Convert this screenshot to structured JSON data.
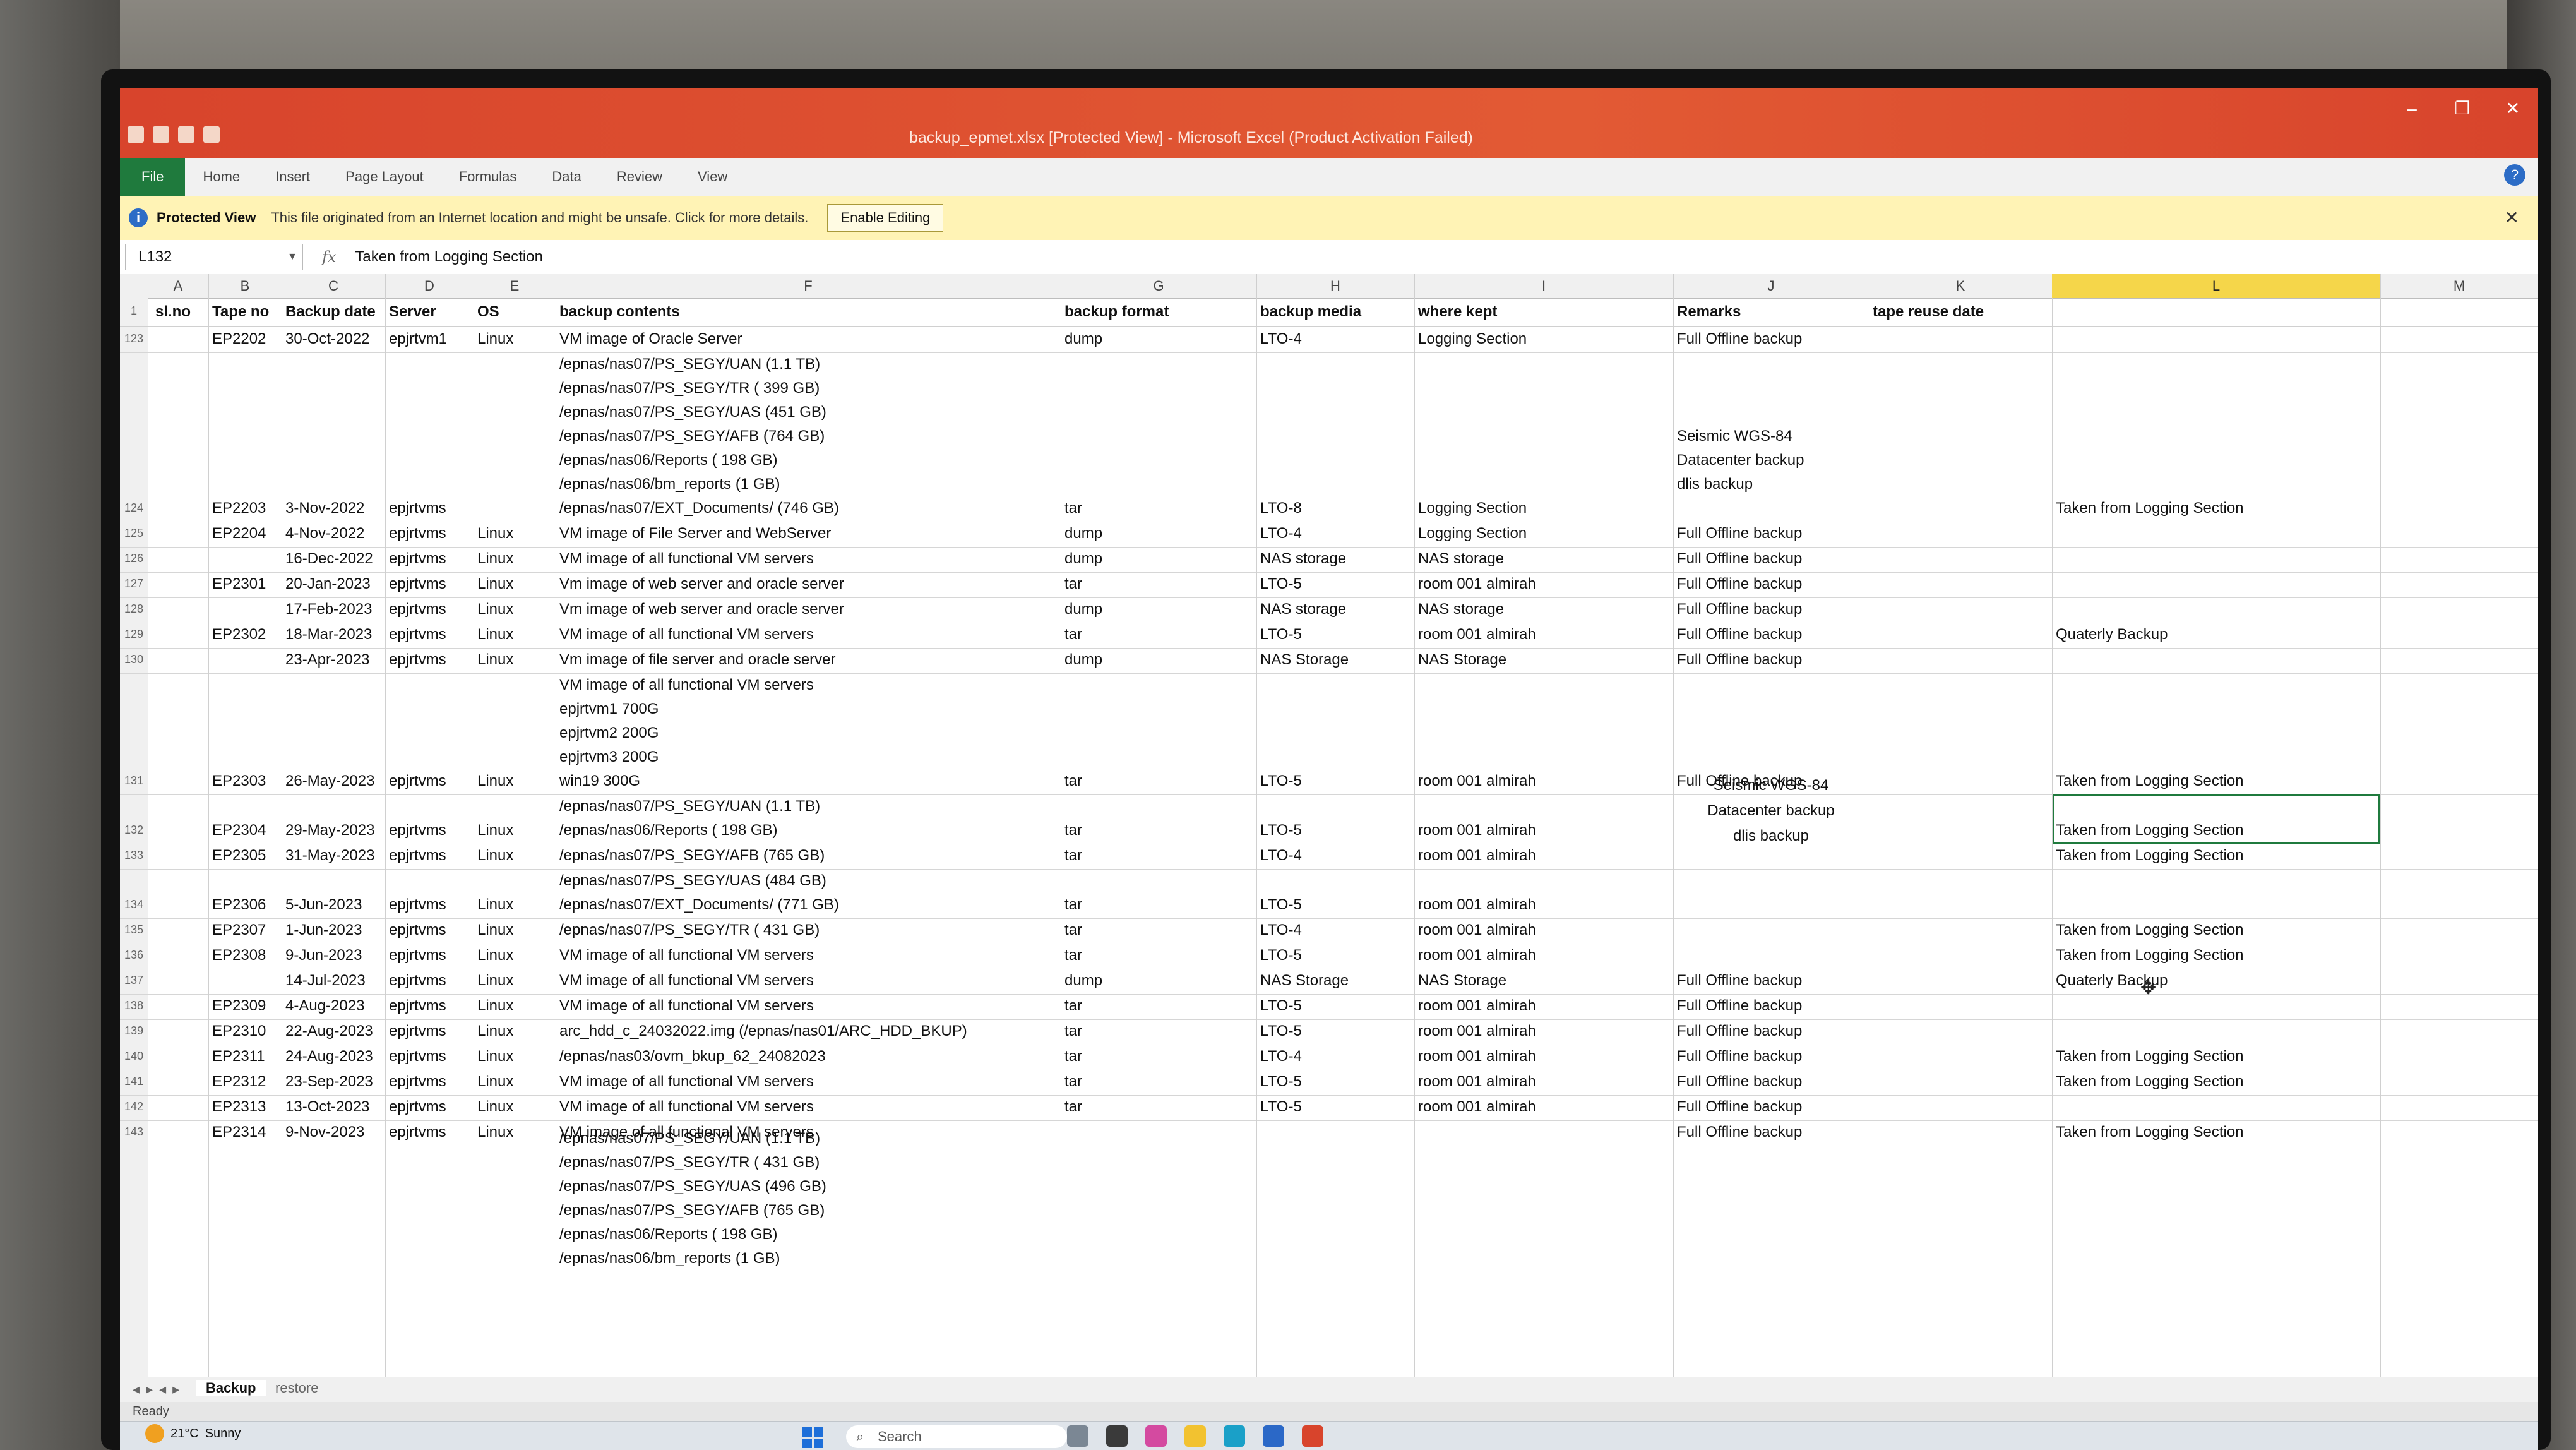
{
  "window": {
    "title": "backup_epmet.xlsx [Protected View] - Microsoft Excel (Product Activation Failed)"
  },
  "ribbon": {
    "tabs": [
      "File",
      "Home",
      "Insert",
      "Page Layout",
      "Formulas",
      "Data",
      "Review",
      "View"
    ]
  },
  "protected_view": {
    "label": "Protected View",
    "message": "This file originated from an Internet location and might be unsafe. Click for more details.",
    "button": "Enable Editing"
  },
  "formula_bar": {
    "name_box": "L132",
    "fx": "fx",
    "value": "Taken from Logging Section"
  },
  "columns": [
    "A",
    "B",
    "C",
    "D",
    "E",
    "F",
    "G",
    "H",
    "I",
    "J",
    "K",
    "L",
    "M"
  ],
  "header_row": {
    "row_num": "1",
    "sl_no": "sl.no",
    "tape_no": "Tape no",
    "backup_date": "Backup date",
    "server": "Server",
    "os": "OS",
    "backup_contents": "backup contents",
    "backup_format": "backup format",
    "backup_media": "backup media",
    "where_kept": "where kept",
    "remarks": "Remarks",
    "tape_reuse_date": "tape reuse date"
  },
  "rows": [
    {
      "num": "123",
      "tape": "EP2202",
      "date": "30-Oct-2022",
      "server": "epjrtvm1",
      "os": "Linux",
      "contents": "VM image of Oracle Server",
      "format": "dump",
      "media": "LTO-4",
      "kept": "Logging Section",
      "remarks": "Full Offline backup",
      "note": ""
    },
    {
      "num": "124",
      "tape": "EP2203",
      "date": "3-Nov-2022",
      "server": "epjrtvms",
      "os": "",
      "contents_lines": [
        "/epnas/nas07/PS_SEGY/UAN (1.1 TB)",
        "/epnas/nas07/PS_SEGY/TR ( 399 GB)",
        "/epnas/nas07/PS_SEGY/UAS (451 GB)",
        "/epnas/nas07/PS_SEGY/AFB (764 GB)",
        "/epnas/nas06/Reports ( 198 GB)",
        "/epnas/nas06/bm_reports (1 GB)",
        "/epnas/nas07/EXT_Documents/ (746 GB)"
      ],
      "format": "tar",
      "media": "LTO-8",
      "kept": "Logging Section",
      "remarks_lines": [
        "Seismic WGS-84",
        "Datacenter backup",
        "dlis backup"
      ],
      "note": "Taken from Logging Section"
    },
    {
      "num": "125",
      "tape": "EP2204",
      "date": "4-Nov-2022",
      "server": "epjrtvms",
      "os": "Linux",
      "contents": "VM image of File Server and WebServer",
      "format": "dump",
      "media": "LTO-4",
      "kept": "Logging Section",
      "remarks": "Full Offline backup",
      "note": ""
    },
    {
      "num": "126",
      "tape": "",
      "date": "16-Dec-2022",
      "server": "epjrtvms",
      "os": "Linux",
      "contents": "VM image of all functional VM servers",
      "format": "dump",
      "media": "NAS storage",
      "kept": "NAS storage",
      "remarks": "Full Offline backup",
      "note": ""
    },
    {
      "num": "127",
      "tape": "EP2301",
      "date": "20-Jan-2023",
      "server": "epjrtvms",
      "os": "Linux",
      "contents": "Vm image of web server and oracle server",
      "format": "tar",
      "media": "LTO-5",
      "kept": "room 001 almirah",
      "remarks": "Full Offline backup",
      "note": ""
    },
    {
      "num": "128",
      "tape": "",
      "date": "17-Feb-2023",
      "server": "epjrtvms",
      "os": "Linux",
      "contents": "Vm image of web server and oracle server",
      "format": "dump",
      "media": "NAS storage",
      "kept": "NAS storage",
      "remarks": "Full Offline backup",
      "note": ""
    },
    {
      "num": "129",
      "tape": "EP2302",
      "date": "18-Mar-2023",
      "server": "epjrtvms",
      "os": "Linux",
      "contents": "VM image of all functional VM servers",
      "format": "tar",
      "media": "LTO-5",
      "kept": "room 001 almirah",
      "remarks": "Full Offline backup",
      "note": "Quaterly Backup"
    },
    {
      "num": "130",
      "tape": "",
      "date": "23-Apr-2023",
      "server": "epjrtvms",
      "os": "Linux",
      "contents": "Vm image of file server and oracle server",
      "format": "dump",
      "media": "NAS Storage",
      "kept": "NAS Storage",
      "remarks": "Full Offline backup",
      "note": ""
    },
    {
      "num": "131",
      "tape": "EP2303",
      "date": "26-May-2023",
      "server": "epjrtvms",
      "os": "Linux",
      "contents_lines": [
        "VM image of all functional VM servers",
        "epjrtvm1 700G",
        "epjrtvm2 200G",
        "epjrtvm3 200G",
        "win19 300G"
      ],
      "format": "tar",
      "media": "LTO-5",
      "kept": "room 001 almirah",
      "remarks": "Full Offline backup",
      "note": "Taken from Logging Section"
    },
    {
      "num": "132",
      "tape": "EP2304",
      "date": "29-May-2023",
      "server": "epjrtvms",
      "os": "Linux",
      "contents_lines": [
        "/epnas/nas07/PS_SEGY/UAN (1.1 TB)",
        "/epnas/nas06/Reports ( 198 GB)"
      ],
      "format": "tar",
      "media": "LTO-5",
      "kept": "room 001 almirah",
      "remarks": "",
      "note": "Taken from Logging Section"
    },
    {
      "num": "133",
      "tape": "EP2305",
      "date": "31-May-2023",
      "server": "epjrtvms",
      "os": "Linux",
      "contents": "/epnas/nas07/PS_SEGY/AFB (765 GB)",
      "format": "tar",
      "media": "LTO-4",
      "kept": "room 001 almirah",
      "remarks": "",
      "note": "Taken from Logging Section"
    },
    {
      "num": "134",
      "tape": "EP2306",
      "date": "5-Jun-2023",
      "server": "epjrtvms",
      "os": "Linux",
      "contents_lines": [
        "/epnas/nas07/PS_SEGY/UAS (484 GB)",
        "/epnas/nas07/EXT_Documents/ (771 GB)"
      ],
      "format": "tar",
      "media": "LTO-5",
      "kept": "room 001 almirah",
      "remarks": "",
      "note": ""
    },
    {
      "num": "135",
      "tape": "EP2307",
      "date": "1-Jun-2023",
      "server": "epjrtvms",
      "os": "Linux",
      "contents": "/epnas/nas07/PS_SEGY/TR ( 431 GB)",
      "format": "tar",
      "media": "LTO-4",
      "kept": "room 001 almirah",
      "remarks": "",
      "note": "Taken from Logging Section"
    },
    {
      "num": "136",
      "tape": "EP2308",
      "date": "9-Jun-2023",
      "server": "epjrtvms",
      "os": "Linux",
      "contents": "VM image of all functional VM servers",
      "format": "tar",
      "media": "LTO-5",
      "kept": "room 001 almirah",
      "remarks": "",
      "note": "Taken from Logging Section"
    },
    {
      "num": "137",
      "tape": "",
      "date": "14-Jul-2023",
      "server": "epjrtvms",
      "os": "Linux",
      "contents": "VM image of all functional VM servers",
      "format": "dump",
      "media": "NAS Storage",
      "kept": "NAS Storage",
      "remarks": "Full Offline backup",
      "note": "Quaterly Backup"
    },
    {
      "num": "138",
      "tape": "EP2309",
      "date": "4-Aug-2023",
      "server": "epjrtvms",
      "os": "Linux",
      "contents": "VM image of all functional VM servers",
      "format": "tar",
      "media": "LTO-5",
      "kept": "room 001 almirah",
      "remarks": "Full Offline backup",
      "note": ""
    },
    {
      "num": "139",
      "tape": "EP2310",
      "date": "22-Aug-2023",
      "server": "epjrtvms",
      "os": "Linux",
      "contents": "arc_hdd_c_24032022.img (/epnas/nas01/ARC_HDD_BKUP)",
      "format": "tar",
      "media": "LTO-5",
      "kept": "room 001 almirah",
      "remarks": "Full Offline backup",
      "note": ""
    },
    {
      "num": "140",
      "tape": "EP2311",
      "date": "24-Aug-2023",
      "server": "epjrtvms",
      "os": "Linux",
      "contents": "/epnas/nas03/ovm_bkup_62_24082023",
      "format": "tar",
      "media": "LTO-4",
      "kept": "room 001 almirah",
      "remarks": "Full Offline backup",
      "note": "Taken from Logging Section"
    },
    {
      "num": "141",
      "tape": "EP2312",
      "date": "23-Sep-2023",
      "server": "epjrtvms",
      "os": "Linux",
      "contents": "VM image of all functional VM servers",
      "format": "tar",
      "media": "LTO-5",
      "kept": "room 001 almirah",
      "remarks": "Full Offline backup",
      "note": "Taken from Logging Section"
    },
    {
      "num": "142",
      "tape": "EP2313",
      "date": "13-Oct-2023",
      "server": "epjrtvms",
      "os": "Linux",
      "contents": "VM image of all functional VM servers",
      "format": "tar",
      "media": "LTO-5",
      "kept": "room 001 almirah",
      "remarks": "Full Offline backup",
      "note": ""
    },
    {
      "num": "143",
      "tape": "EP2314",
      "date": "9-Nov-2023",
      "server": "epjrtvms",
      "os": "Linux",
      "contents": "VM image of all functional VM servers",
      "format": "",
      "media": "",
      "kept": "",
      "remarks": "Full Offline backup",
      "note": "Taken from Logging Section"
    }
  ],
  "merged_remarks_lines": [
    "Seismic WGS-84",
    "Datacenter backup",
    "dlis backup"
  ],
  "trailing_contents_lines": [
    "/epnas/nas07/PS_SEGY/UAN (1.1 TB)",
    "/epnas/nas07/PS_SEGY/TR ( 431 GB)",
    "/epnas/nas07/PS_SEGY/UAS (496 GB)",
    "/epnas/nas07/PS_SEGY/AFB (765 GB)",
    "/epnas/nas06/Reports ( 198 GB)",
    "/epnas/nas06/bm_reports (1 GB)"
  ],
  "sheets": [
    "Backup",
    "restore"
  ],
  "status": "Ready",
  "taskbar": {
    "weather_temp": "21°C",
    "weather_desc": "Sunny",
    "search": "Search"
  },
  "colors": {
    "title_bar": "#d8442c",
    "file_tab": "#1f7a3d",
    "protected_bar": "#fff3b5",
    "selected_column": "#f5d64a"
  }
}
